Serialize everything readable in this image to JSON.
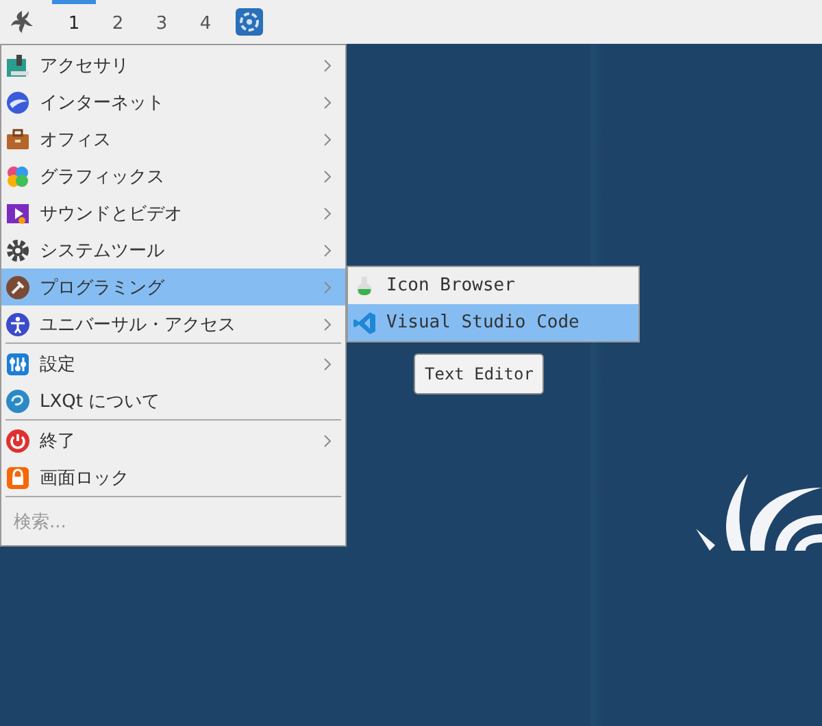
{
  "panel": {
    "workspaces": [
      {
        "label": "1",
        "selected": true
      },
      {
        "label": "2",
        "selected": false
      },
      {
        "label": "3",
        "selected": false
      },
      {
        "label": "4",
        "selected": false
      }
    ]
  },
  "menu": {
    "items": [
      {
        "kind": "item",
        "label": "アクセサリ",
        "submenu": true,
        "selected": false
      },
      {
        "kind": "item",
        "label": "インターネット",
        "submenu": true,
        "selected": false
      },
      {
        "kind": "item",
        "label": "オフィス",
        "submenu": true,
        "selected": false
      },
      {
        "kind": "item",
        "label": "グラフィックス",
        "submenu": true,
        "selected": false
      },
      {
        "kind": "item",
        "label": "サウンドとビデオ",
        "submenu": true,
        "selected": false
      },
      {
        "kind": "item",
        "label": "システムツール",
        "submenu": true,
        "selected": false
      },
      {
        "kind": "item",
        "label": "プログラミング",
        "submenu": true,
        "selected": true
      },
      {
        "kind": "item",
        "label": "ユニバーサル・アクセス",
        "submenu": true,
        "selected": false
      },
      {
        "kind": "separator"
      },
      {
        "kind": "item",
        "label": "設定",
        "submenu": true,
        "selected": false
      },
      {
        "kind": "item",
        "label": "LXQt について",
        "submenu": false,
        "selected": false
      },
      {
        "kind": "separator"
      },
      {
        "kind": "item",
        "label": "終了",
        "submenu": true,
        "selected": false
      },
      {
        "kind": "item",
        "label": "画面ロック",
        "submenu": false,
        "selected": false
      },
      {
        "kind": "separator"
      }
    ],
    "search": {
      "placeholder": "検索..."
    }
  },
  "submenu": {
    "items": [
      {
        "label": "Icon Browser",
        "selected": false
      },
      {
        "label": "Visual Studio Code",
        "selected": true
      }
    ]
  },
  "tooltip": {
    "text": "Text Editor"
  }
}
